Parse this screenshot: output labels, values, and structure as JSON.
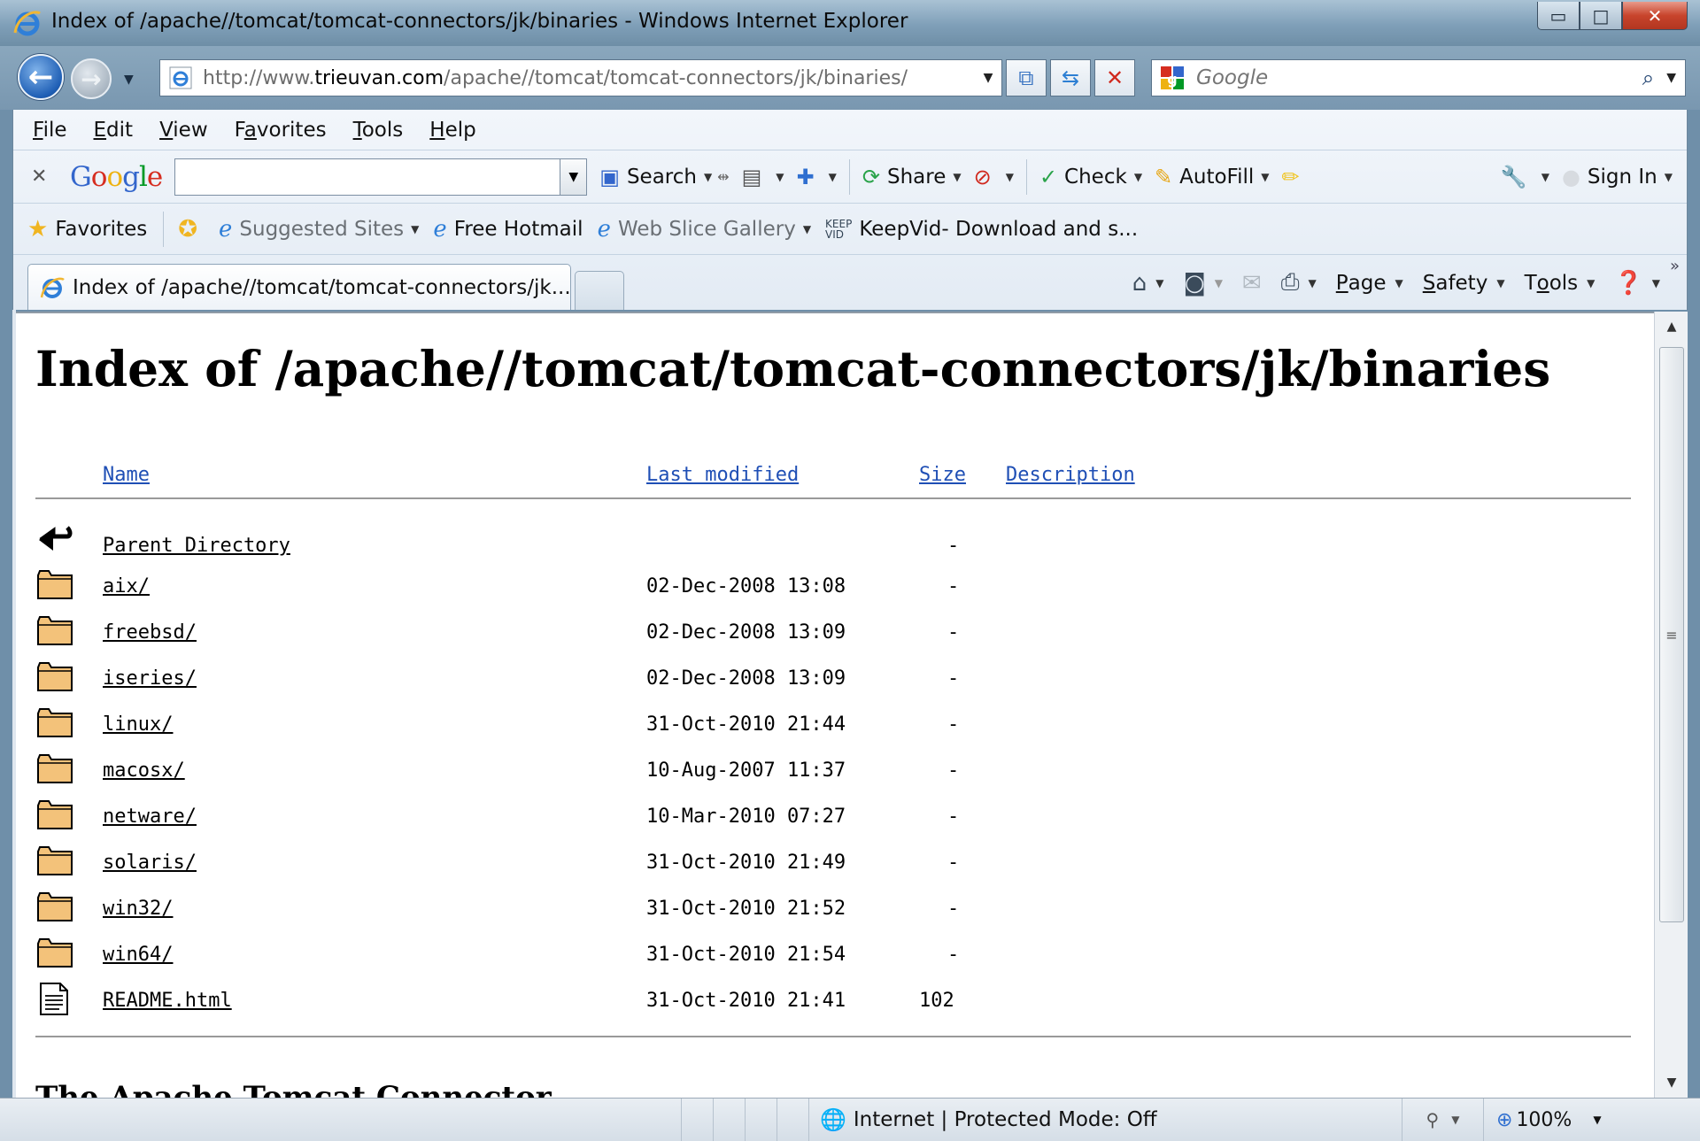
{
  "window": {
    "title": "Index of /apache//tomcat/tomcat-connectors/jk/binaries - Windows Internet Explorer",
    "minimize": "▭",
    "maximize": "□",
    "close": "✕"
  },
  "address": {
    "prefix": "http://www.",
    "host": "trieuvan.com",
    "path": "/apache//tomcat/tomcat-connectors/jk/binaries/"
  },
  "search": {
    "placeholder": "Google"
  },
  "menu": {
    "items": [
      {
        "key": "F",
        "rest": "ile"
      },
      {
        "key": "E",
        "rest": "dit"
      },
      {
        "key": "V",
        "rest": "iew"
      },
      {
        "key": "F",
        "pre": "",
        "label": "Favorites",
        "key_index": 1
      },
      {
        "key": "T",
        "rest": "ools"
      },
      {
        "key": "H",
        "rest": "elp"
      }
    ],
    "favorites_pre": "F",
    "favorites_key": "a",
    "favorites_rest": "vorites"
  },
  "google_toolbar": {
    "search": "Search",
    "share": "Share",
    "check": "Check",
    "autofill": "AutoFill",
    "sign_in": "Sign In"
  },
  "favorites_bar": {
    "favorites": "Favorites",
    "suggested": "Suggested Sites",
    "hotmail": "Free Hotmail",
    "webslice": "Web Slice Gallery",
    "keepvid": "KeepVid- Download and s..."
  },
  "tab": {
    "title": "Index of /apache//tomcat/tomcat-connectors/jk..."
  },
  "command_bar": {
    "page_key": "P",
    "page_rest": "age",
    "safety_key": "S",
    "safety_rest": "afety",
    "tools_pre": "T",
    "tools_key": "o",
    "tools_rest": "ols"
  },
  "page": {
    "heading": "Index of /apache//tomcat/tomcat-connectors/jk/binaries",
    "columns": {
      "name": "Name",
      "modified": "Last modified",
      "size": "Size",
      "description": "Description"
    },
    "rows": [
      {
        "name": "Parent Directory",
        "modified": "",
        "size": "-",
        "icon": "back-icon"
      },
      {
        "name": "aix/",
        "modified": "02-Dec-2008 13:08",
        "size": "-",
        "icon": "folder-icon"
      },
      {
        "name": "freebsd/",
        "modified": "02-Dec-2008 13:09",
        "size": "-",
        "icon": "folder-icon"
      },
      {
        "name": "iseries/",
        "modified": "02-Dec-2008 13:09",
        "size": "-",
        "icon": "folder-icon"
      },
      {
        "name": "linux/",
        "modified": "31-Oct-2010 21:44",
        "size": "-",
        "icon": "folder-icon"
      },
      {
        "name": "macosx/",
        "modified": "10-Aug-2007 11:37",
        "size": "-",
        "icon": "folder-icon"
      },
      {
        "name": "netware/",
        "modified": "10-Mar-2010 07:27",
        "size": "-",
        "icon": "folder-icon"
      },
      {
        "name": "solaris/",
        "modified": "31-Oct-2010 21:49",
        "size": "-",
        "icon": "folder-icon"
      },
      {
        "name": "win32/",
        "modified": "31-Oct-2010 21:52",
        "size": "-",
        "icon": "folder-icon"
      },
      {
        "name": "win64/",
        "modified": "31-Oct-2010 21:54",
        "size": "-",
        "icon": "folder-icon"
      },
      {
        "name": "README.html",
        "modified": "31-Oct-2010 21:41",
        "size": "102",
        "icon": "document-icon"
      }
    ],
    "footer_heading": "The Apache Tomcat Connector"
  },
  "status": {
    "zone": "Internet | Protected Mode: Off",
    "zoom": "100%"
  }
}
